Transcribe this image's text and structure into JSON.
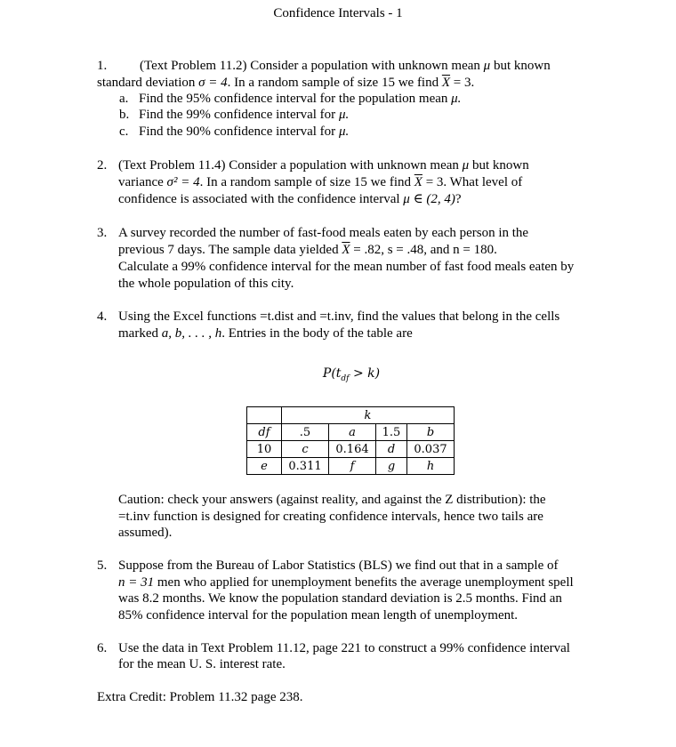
{
  "document": {
    "title": "Confidence Intervals - 1",
    "problem1": {
      "number": "1.",
      "line1_pre": "(Text Problem 11.2)   Consider a population with unknown mean ",
      "mu": "μ",
      "line1_post": " but known",
      "line2_pre": "standard deviation ",
      "sigma_eq": "σ = 4",
      "line2_mid": ".  In a random sample of size 15 we find ",
      "xbar": "X",
      "line2_post": " = 3.",
      "items": [
        {
          "label": "a.",
          "text": "Find the 95% confidence interval for the population mean ",
          "tail": "μ."
        },
        {
          "label": "b.",
          "text": "Find the 99% confidence interval for ",
          "tail": "μ."
        },
        {
          "label": "c.",
          "text": "Find the 90% confidence interval for ",
          "tail": "μ."
        }
      ]
    },
    "problem2": {
      "number": "2.",
      "line1_pre": "(Text Problem 11.4)   Consider a population with unknown mean ",
      "mu": "μ",
      "line1_post": " but known",
      "line2_pre": "variance ",
      "sigma_sq": "σ² = 4",
      "line2_mid": ".  In a random sample of size 15 we find ",
      "xbar": "X",
      "line2_post": " = 3.  What level of",
      "line3_pre": "confidence is associated with the confidence interval ",
      "interval": "μ ∈ (2, 4)",
      "line3_post": "?"
    },
    "problem3": {
      "number": "3.",
      "line1": "A survey recorded the number of fast-food meals eaten by each person in the",
      "line2_pre": "previous 7 days.  The sample data yielded ",
      "xbar": "X",
      "line2_post": " = .82,  s = .48,  and n = 180.",
      "line3": "Calculate a 99% confidence interval for the mean number of fast food meals eaten by",
      "line4": "the whole population of this city."
    },
    "problem4": {
      "number": "4.",
      "line1": "Using the Excel functions =t.dist and =t.inv, find the values that belong in the cells",
      "line2_pre": "marked ",
      "vars": "a, b, . . . , h",
      "line2_post": ".  Entries in the body of the table are",
      "formula": "P(t",
      "formula_sub": "df",
      "formula_post": " > k)",
      "table": {
        "header": "k",
        "rows": [
          [
            "df",
            ".5",
            "a",
            "1.5",
            "b"
          ],
          [
            "10",
            "c",
            "0.164",
            "d",
            "0.037"
          ],
          [
            "e",
            "0.311",
            "f",
            "g",
            "h"
          ]
        ]
      },
      "caution_lines": [
        "Caution: check your answers (against reality, and against the Z distribution): the",
        "=t.inv function is designed for creating confidence intervals, hence two tails are",
        "assumed)."
      ]
    },
    "problem5": {
      "number": "5.",
      "line1": "Suppose from the Bureau of Labor Statistics (BLS) we find out that in a sample of",
      "line2_math": "n = 31",
      "line2_post": " men who applied for unemployment benefits the average unemployment spell",
      "line3": "was 8.2 months.  We know the population standard deviation is 2.5 months.  Find an",
      "line4": "85% confidence interval for the population mean length of unemployment."
    },
    "problem6": {
      "number": "6.",
      "line1": "Use the data in Text Problem 11.12, page 221 to construct a 99% confidence interval",
      "line2": "for the mean U. S. interest rate."
    },
    "extra_credit": "Extra Credit: Problem 11.32 page 238."
  }
}
